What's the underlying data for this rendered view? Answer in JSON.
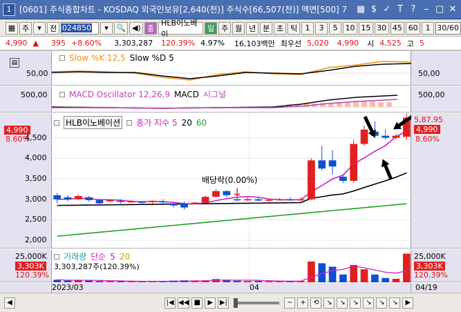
{
  "window": {
    "number": "1",
    "title": "[0601] 주식종합차트 - KOSDAQ 외국인보유[2,640(천)] 주식수[66,507(천)] 액면[500] 7",
    "icons": [
      "grid-icon",
      "dollar-icon",
      "check-icon",
      "T-icon",
      "help-icon",
      "minimize-icon",
      "maximize-icon",
      "close-icon"
    ]
  },
  "toolbar": {
    "type_select": "주",
    "type2": "전",
    "stock_code": "024850",
    "stock_name": "HLB이노베이",
    "pink_btn": "종",
    "period_buttons": [
      "일",
      "주",
      "월",
      "년",
      "분",
      "초",
      "틱"
    ],
    "active_period": "일",
    "interval_buttons": [
      "1",
      "3",
      "5",
      "10",
      "15",
      "30",
      "45",
      "60"
    ],
    "interval_select": "1",
    "view_count": "30/60"
  },
  "quote": {
    "price": "4,990",
    "direction": "▲",
    "change": "395",
    "change_pct": "+8.60%",
    "volume": "3,303,287",
    "volume_ratio": "120.39%",
    "turnover": "4.97%",
    "trade_value": "16,103백만",
    "best_ask_label": "최우선",
    "best_ask": "5,020",
    "best_bid": "4,990",
    "open_label": "시",
    "open": "4,525",
    "high_label": "고",
    "high": "5"
  },
  "panes": {
    "stoch": {
      "legend_main": "Slow %K 12,5",
      "legend_sub": "Slow %D 5",
      "label_left": "50,00",
      "label_right": "50,00"
    },
    "macd": {
      "legend_main": "MACD Oscillator 12,26,9",
      "legend_sub": "MACD",
      "legend_sig": "시그널",
      "label_left": "500,00",
      "label_right": "500,00"
    },
    "price": {
      "legend_name": "HLB이노베이션",
      "legend_ma": "종가 지수 5",
      "legend_ma2": "20",
      "legend_ma3": "60",
      "tag_price": "4,990",
      "tag_pct": "8.60%",
      "right_top": "5,87.95",
      "right_price": "4,990",
      "right_pct": "8.60%",
      "annotation": "배당락(0.00%)",
      "yticks": [
        "4,500",
        "4,000",
        "3,500",
        "3,000",
        "2,500",
        "2,000"
      ]
    },
    "volume": {
      "legend_name": "거래량",
      "legend_sub": "단순",
      "legend_sub2": "5",
      "legend_sub3": "20",
      "detail": "3,303,287주(120.39%)",
      "label_left": "25,000K",
      "tag_left": "3,303K",
      "pct_left": "120.39%",
      "label_right": "25,000K",
      "tag_right": "3,303K",
      "pct_right": "120.39%"
    }
  },
  "xaxis": {
    "left": "2023/03",
    "mid": "04",
    "right": "04/19"
  },
  "chart_data": {
    "type": "candlestick",
    "y_range": [
      1800,
      5100
    ],
    "candles": [
      {
        "o": 3100,
        "h": 3150,
        "l": 2900,
        "c": 3000
      },
      {
        "o": 3050,
        "h": 3100,
        "l": 2950,
        "c": 3000
      },
      {
        "o": 3000,
        "h": 3120,
        "l": 2980,
        "c": 3080
      },
      {
        "o": 3050,
        "h": 3080,
        "l": 2950,
        "c": 2980
      },
      {
        "o": 2980,
        "h": 3000,
        "l": 2850,
        "c": 2900
      },
      {
        "o": 2950,
        "h": 3000,
        "l": 2920,
        "c": 2980
      },
      {
        "o": 2960,
        "h": 3000,
        "l": 2900,
        "c": 2940
      },
      {
        "o": 2950,
        "h": 2990,
        "l": 2920,
        "c": 2950
      },
      {
        "o": 2940,
        "h": 2960,
        "l": 2900,
        "c": 2930
      },
      {
        "o": 2930,
        "h": 2970,
        "l": 2880,
        "c": 2960
      },
      {
        "o": 2950,
        "h": 3000,
        "l": 2900,
        "c": 2930
      },
      {
        "o": 2900,
        "h": 2930,
        "l": 2800,
        "c": 2850
      },
      {
        "o": 2900,
        "h": 2950,
        "l": 2750,
        "c": 2800
      },
      {
        "o": 2900,
        "h": 2940,
        "l": 2880,
        "c": 2920
      },
      {
        "o": 2920,
        "h": 3100,
        "l": 2900,
        "c": 3060
      },
      {
        "o": 3060,
        "h": 3250,
        "l": 3050,
        "c": 3200
      },
      {
        "o": 3200,
        "h": 3220,
        "l": 3050,
        "c": 3100
      },
      {
        "o": 3000,
        "h": 3050,
        "l": 2950,
        "c": 2980
      },
      {
        "o": 2980,
        "h": 3050,
        "l": 2960,
        "c": 3000
      },
      {
        "o": 3000,
        "h": 3050,
        "l": 2950,
        "c": 2970
      },
      {
        "o": 2970,
        "h": 3000,
        "l": 2930,
        "c": 2990
      },
      {
        "o": 2990,
        "h": 3030,
        "l": 2970,
        "c": 3000
      },
      {
        "o": 3000,
        "h": 3050,
        "l": 2960,
        "c": 2980
      },
      {
        "o": 2980,
        "h": 3050,
        "l": 2950,
        "c": 3000
      },
      {
        "o": 3000,
        "h": 4000,
        "l": 2980,
        "c": 3950
      },
      {
        "o": 3950,
        "h": 4300,
        "l": 3700,
        "c": 3750
      },
      {
        "o": 3950,
        "h": 4200,
        "l": 3600,
        "c": 3800
      },
      {
        "o": 3550,
        "h": 3600,
        "l": 3400,
        "c": 3450
      },
      {
        "o": 3450,
        "h": 4450,
        "l": 3400,
        "c": 4350
      },
      {
        "o": 4350,
        "h": 4800,
        "l": 4300,
        "c": 4700
      },
      {
        "o": 4650,
        "h": 4900,
        "l": 4500,
        "c": 4550
      },
      {
        "o": 4550,
        "h": 4700,
        "l": 4450,
        "c": 4500
      },
      {
        "o": 4500,
        "h": 4600,
        "l": 4450,
        "c": 4550
      },
      {
        "o": 4525,
        "h": 5100,
        "l": 4450,
        "c": 4990
      }
    ],
    "volume": [
      300,
      200,
      250,
      200,
      150,
      120,
      130,
      110,
      100,
      150,
      120,
      200,
      230,
      160,
      220,
      380,
      300,
      180,
      150,
      160,
      130,
      140,
      120,
      150,
      2400,
      2200,
      1800,
      900,
      2000,
      1500,
      900,
      500,
      400,
      3303
    ]
  }
}
